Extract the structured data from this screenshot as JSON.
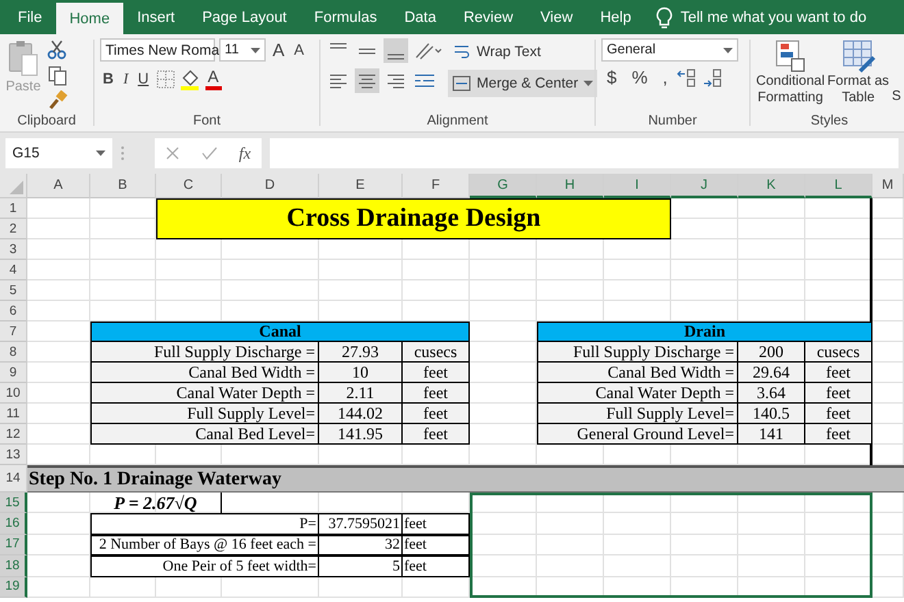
{
  "ribbon_tabs": [
    {
      "label": "File",
      "selected": false
    },
    {
      "label": "Home",
      "selected": true
    },
    {
      "label": "Insert",
      "selected": false
    },
    {
      "label": "Page Layout",
      "selected": false
    },
    {
      "label": "Formulas",
      "selected": false
    },
    {
      "label": "Data",
      "selected": false
    },
    {
      "label": "Review",
      "selected": false
    },
    {
      "label": "View",
      "selected": false
    },
    {
      "label": "Help",
      "selected": false
    }
  ],
  "tell_me": "Tell me what you want to do",
  "clipboard": {
    "paste": "Paste",
    "label": "Clipboard"
  },
  "font": {
    "name": "Times New Roma",
    "size": "11",
    "grow": "A",
    "shrink": "A",
    "bold": "B",
    "italic": "I",
    "underline": "U",
    "font_color_glyph": "A",
    "label": "Font"
  },
  "alignment": {
    "wrap_text": "Wrap Text",
    "merge": "Merge & Center",
    "label": "Alignment"
  },
  "number": {
    "format": "General",
    "currency": "$",
    "percent": "%",
    "comma": ",",
    "label": "Number"
  },
  "styles": {
    "conditional": [
      "Conditional",
      "Formatting"
    ],
    "table": [
      "Format as",
      "Table"
    ],
    "cell_styles": "S",
    "label": "Styles"
  },
  "formula_bar": {
    "name_box": "G15",
    "fx": "fx"
  },
  "columns": [
    {
      "label": "A",
      "selected": false
    },
    {
      "label": "B",
      "selected": false
    },
    {
      "label": "C",
      "selected": false
    },
    {
      "label": "D",
      "selected": false
    },
    {
      "label": "E",
      "selected": false
    },
    {
      "label": "F",
      "selected": false
    },
    {
      "label": "G",
      "selected": true
    },
    {
      "label": "H",
      "selected": true
    },
    {
      "label": "I",
      "selected": true
    },
    {
      "label": "J",
      "selected": true
    },
    {
      "label": "K",
      "selected": true
    },
    {
      "label": "L",
      "selected": true
    },
    {
      "label": "M",
      "selected": false
    }
  ],
  "rows": [
    {
      "label": "1",
      "selected": false
    },
    {
      "label": "2",
      "selected": false
    },
    {
      "label": "3",
      "selected": false
    },
    {
      "label": "4",
      "selected": false
    },
    {
      "label": "5",
      "selected": false
    },
    {
      "label": "6",
      "selected": false
    },
    {
      "label": "7",
      "selected": false
    },
    {
      "label": "8",
      "selected": false
    },
    {
      "label": "9",
      "selected": false
    },
    {
      "label": "10",
      "selected": false
    },
    {
      "label": "11",
      "selected": false
    },
    {
      "label": "12",
      "selected": false
    },
    {
      "label": "13",
      "selected": false
    },
    {
      "label": "14",
      "selected": false
    },
    {
      "label": "15",
      "selected": true
    },
    {
      "label": "16",
      "selected": true
    },
    {
      "label": "17",
      "selected": true
    },
    {
      "label": "18",
      "selected": true
    },
    {
      "label": "19",
      "selected": true
    }
  ],
  "title": "Cross Drainage Design",
  "canal": {
    "heading": "Canal",
    "rows": [
      {
        "label": "Full Supply Discharge =",
        "value": "27.93",
        "unit": "cusecs"
      },
      {
        "label": "Canal Bed Width =",
        "value": "10",
        "unit": "feet"
      },
      {
        "label": "Canal Water Depth =",
        "value": "2.11",
        "unit": "feet"
      },
      {
        "label": "Full Supply Level=",
        "value": "144.02",
        "unit": "feet"
      },
      {
        "label": "Canal Bed Level=",
        "value": "141.95",
        "unit": "feet"
      }
    ]
  },
  "drain": {
    "heading": "Drain",
    "rows": [
      {
        "label": "Full Supply Discharge =",
        "value": "200",
        "unit": "cusecs"
      },
      {
        "label": "Canal Bed Width =",
        "value": "29.64",
        "unit": "feet"
      },
      {
        "label": "Canal Water Depth =",
        "value": "3.64",
        "unit": "feet"
      },
      {
        "label": "Full Supply Level=",
        "value": "140.5",
        "unit": "feet"
      },
      {
        "label": "General Ground Level=",
        "value": "141",
        "unit": "feet"
      }
    ]
  },
  "step_heading": "Step No. 1 Drainage Waterway",
  "formula": "P = 2.67√Q",
  "waterway": [
    {
      "label": "P=",
      "value": "37.7595021",
      "unit": "feet"
    },
    {
      "label": "2 Number of Bays @ 16 feet each =",
      "value": "32",
      "unit": "feet"
    },
    {
      "label": "One Peir of 5 feet width=",
      "value": "5",
      "unit": "feet"
    }
  ]
}
